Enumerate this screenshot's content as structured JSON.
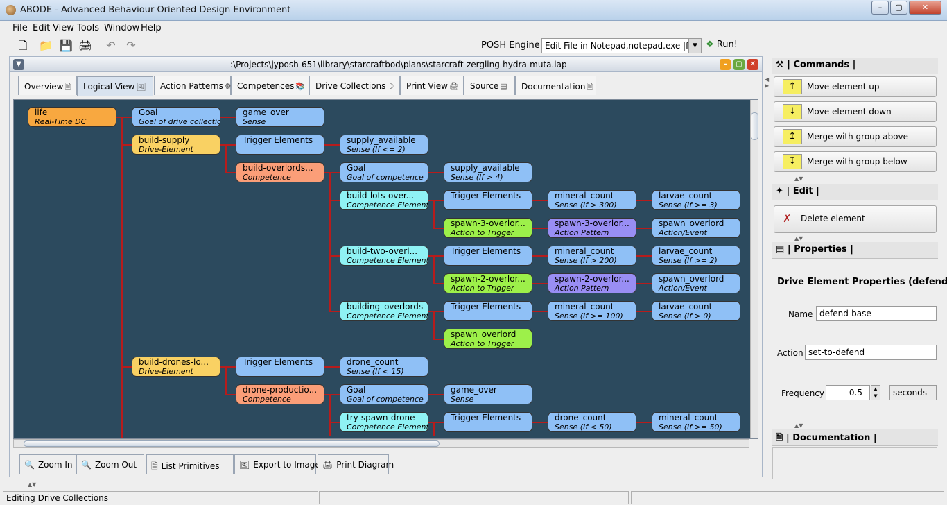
{
  "window": {
    "title": "ABODE - Advanced Behaviour Oriented Design Environment"
  },
  "menu": [
    "File",
    "Edit",
    "View",
    "Tools",
    "Window",
    "Help"
  ],
  "toolbar": {
    "posh_label": "POSH Engine:",
    "posh_value": "Edit File in Notepad,notepad.exe |file|",
    "run_label": "Run!"
  },
  "document": {
    "title": ":\\Projects\\jyposh-651\\library\\starcraftbod\\plans\\starcraft-zergling-hydra-muta.lap"
  },
  "tabs": [
    "Overview",
    "Logical View",
    "Action Patterns",
    "Competences",
    "Drive Collections",
    "Print View",
    "Source",
    "Documentation"
  ],
  "tree_nodes": [
    {
      "id": "life",
      "label": "life",
      "type": "Real-Time DC",
      "color": "orange"
    },
    {
      "id": "goal1",
      "label": "Goal",
      "type": "Goal of drive collection",
      "color": "blue"
    },
    {
      "id": "game_over1",
      "label": "game_over",
      "type": "Sense",
      "color": "blue"
    },
    {
      "id": "build_supply",
      "label": "build-supply",
      "type": "Drive-Element",
      "color": "yellow"
    },
    {
      "id": "trig1",
      "label": "Trigger Elements",
      "type": "",
      "color": "blue"
    },
    {
      "id": "supply_avail1",
      "label": "supply_available",
      "type": "Sense (If <= 2)",
      "color": "blue"
    },
    {
      "id": "build_overlords",
      "label": "build-overlords...",
      "type": "Competence",
      "color": "salmon"
    },
    {
      "id": "goal2",
      "label": "Goal",
      "type": "Goal of competence",
      "color": "blue"
    },
    {
      "id": "supply_avail2",
      "label": "supply_available",
      "type": "Sense (If > 4)",
      "color": "blue"
    },
    {
      "id": "build_lots",
      "label": "build-lots-over...",
      "type": "Competence Element",
      "color": "cyan"
    },
    {
      "id": "trig2",
      "label": "Trigger Elements",
      "type": "",
      "color": "blue"
    },
    {
      "id": "mineral1",
      "label": "mineral_count",
      "type": "Sense (If > 300)",
      "color": "blue"
    },
    {
      "id": "larvae1",
      "label": "larvae_count",
      "type": "Sense (If >= 3)",
      "color": "blue"
    },
    {
      "id": "spawn3",
      "label": "spawn-3-overlor...",
      "type": "Action to Trigger",
      "color": "green"
    },
    {
      "id": "spawn3ap",
      "label": "spawn-3-overlor...",
      "type": "Action Pattern",
      "color": "purple"
    },
    {
      "id": "spawn_ov1",
      "label": "spawn_overlord",
      "type": "Action/Event",
      "color": "blue"
    },
    {
      "id": "build_two",
      "label": "build-two-overl...",
      "type": "Competence Element",
      "color": "cyan"
    },
    {
      "id": "trig3",
      "label": "Trigger Elements",
      "type": "",
      "color": "blue"
    },
    {
      "id": "mineral2",
      "label": "mineral_count",
      "type": "Sense (If > 200)",
      "color": "blue"
    },
    {
      "id": "larvae2",
      "label": "larvae_count",
      "type": "Sense (If >= 2)",
      "color": "blue"
    },
    {
      "id": "spawn2",
      "label": "spawn-2-overlor...",
      "type": "Action to Trigger",
      "color": "green"
    },
    {
      "id": "spawn2ap",
      "label": "spawn-2-overlor...",
      "type": "Action Pattern",
      "color": "purple"
    },
    {
      "id": "spawn_ov2",
      "label": "spawn_overlord",
      "type": "Action/Event",
      "color": "blue"
    },
    {
      "id": "building_ov",
      "label": "building_overlords",
      "type": "Competence Element",
      "color": "cyan"
    },
    {
      "id": "trig4",
      "label": "Trigger Elements",
      "type": "",
      "color": "blue"
    },
    {
      "id": "mineral3",
      "label": "mineral_count",
      "type": "Sense (If >= 100)",
      "color": "blue"
    },
    {
      "id": "larvae3",
      "label": "larvae_count",
      "type": "Sense (If > 0)",
      "color": "blue"
    },
    {
      "id": "spawn_ov3",
      "label": "spawn_overlord",
      "type": "Action to Trigger",
      "color": "green"
    },
    {
      "id": "build_drones",
      "label": "build-drones-lo...",
      "type": "Drive-Element",
      "color": "yellow"
    },
    {
      "id": "trig5",
      "label": "Trigger Elements",
      "type": "",
      "color": "blue"
    },
    {
      "id": "drone_count1",
      "label": "drone_count",
      "type": "Sense (If < 15)",
      "color": "blue"
    },
    {
      "id": "drone_prod",
      "label": "drone-productio...",
      "type": "Competence",
      "color": "salmon"
    },
    {
      "id": "goal3",
      "label": "Goal",
      "type": "Goal of competence",
      "color": "blue"
    },
    {
      "id": "game_over2",
      "label": "game_over",
      "type": "Sense",
      "color": "blue"
    },
    {
      "id": "try_spawn",
      "label": "try-spawn-drone",
      "type": "Competence Element",
      "color": "cyan"
    },
    {
      "id": "trig6",
      "label": "Trigger Elements",
      "type": "",
      "color": "blue"
    },
    {
      "id": "drone_count2",
      "label": "drone_count",
      "type": "Sense (If < 50)",
      "color": "blue"
    },
    {
      "id": "mineral4",
      "label": "mineral_count",
      "type": "Sense (If >= 50)",
      "color": "blue"
    }
  ],
  "bottom_buttons": [
    "Zoom In",
    "Zoom Out",
    "List Primitives",
    "Export to Image",
    "Print Diagram"
  ],
  "panels": {
    "commands": {
      "header": "| Commands |",
      "buttons": [
        "Move element up",
        "Move element down",
        "Merge with group above",
        "Merge with group below"
      ]
    },
    "edit": {
      "header": "| Edit |",
      "delete_label": "Delete element"
    },
    "properties": {
      "header": "| Properties |",
      "title": "Drive Element Properties (defend-ba",
      "name_label": "Name",
      "name_value": "defend-base",
      "action_label": "Action",
      "action_value": "set-to-defend",
      "frequency_label": "Frequency",
      "frequency_value": "0.5",
      "unit_value": "seconds"
    },
    "documentation": {
      "header": "| Documentation |"
    }
  },
  "status": {
    "text": "Editing Drive Collections"
  },
  "colors": {
    "canvas_bg": "#2c4a5e",
    "edge": "#b71c1c",
    "orange": "#f8a840",
    "yellow": "#f9d163",
    "blue": "#8fc0f6",
    "salmon": "#fb9e78",
    "cyan": "#8ff2f4",
    "green": "#9df04a",
    "purple": "#998ef4"
  }
}
